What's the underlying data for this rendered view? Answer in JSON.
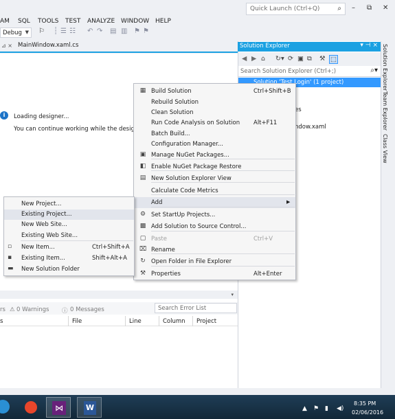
{
  "menubar": {
    "items": [
      "AM",
      "SQL",
      "TOOLS",
      "TEST",
      "ANALYZE",
      "WINDOW",
      "HELP"
    ],
    "quick_launch_placeholder": "Quick Launch (Ctrl+Q)"
  },
  "window_controls": [
    "–",
    "⧉",
    "✕"
  ],
  "toolbar": {
    "config_value": "Debug"
  },
  "editor": {
    "tab_label": "MainWindow.xaml.cs",
    "loading_text": "Loading designer...",
    "continue_text": "You can continue working while the designer is"
  },
  "error_list": {
    "errors_fragment": "rs",
    "warnings": "0 Warnings",
    "messages": "0 Messages",
    "search_placeholder": "Search Error List",
    "columns": [
      "File",
      "Line",
      "Column",
      "Project"
    ]
  },
  "solution_explorer": {
    "title": "Solution Explorer",
    "search_placeholder": "Search Solution Explorer (Ctrl+;)",
    "selected_item": "Solution 'Test Login' (1 project)",
    "visible_fragments": [
      "es",
      "ndow.xaml"
    ]
  },
  "side_tabs": [
    "Solution Explorer",
    "Team Explorer",
    "Class View"
  ],
  "context_menu": [
    {
      "icon": "build-icon",
      "glyph": "▦",
      "label": "Build Solution",
      "shortcut": "Ctrl+Shift+B"
    },
    {
      "icon": "",
      "glyph": "",
      "label": "Rebuild Solution",
      "shortcut": ""
    },
    {
      "icon": "",
      "glyph": "",
      "label": "Clean Solution",
      "shortcut": ""
    },
    {
      "icon": "",
      "glyph": "",
      "label": "Run Code Analysis on Solution",
      "shortcut": "Alt+F11"
    },
    {
      "icon": "",
      "glyph": "",
      "label": "Batch Build...",
      "shortcut": ""
    },
    {
      "icon": "",
      "glyph": "",
      "label": "Configuration Manager...",
      "shortcut": ""
    },
    {
      "icon": "nuget-icon",
      "glyph": "▣",
      "label": "Manage NuGet Packages...",
      "shortcut": ""
    },
    {
      "icon": "nuget-restore-icon",
      "glyph": "◧",
      "label": "Enable NuGet Package Restore",
      "shortcut": ""
    },
    {
      "icon": "new-view-icon",
      "glyph": "▤",
      "label": "New Solution Explorer View",
      "shortcut": ""
    },
    {
      "icon": "",
      "glyph": "",
      "label": "Calculate Code Metrics",
      "shortcut": ""
    },
    {
      "icon": "",
      "glyph": "",
      "label": "Add",
      "shortcut": "",
      "submenu": true
    },
    {
      "icon": "gear-icon",
      "glyph": "⚙",
      "label": "Set StartUp Projects...",
      "shortcut": ""
    },
    {
      "icon": "source-control-icon",
      "glyph": "▩",
      "label": "Add Solution to Source Control...",
      "shortcut": ""
    },
    {
      "icon": "paste-icon",
      "glyph": "▢",
      "label": "Paste",
      "shortcut": "Ctrl+V",
      "disabled": true
    },
    {
      "icon": "rename-icon",
      "glyph": "⌧",
      "label": "Rename",
      "shortcut": ""
    },
    {
      "icon": "folder-icon",
      "glyph": "↻",
      "label": "Open Folder in File Explorer",
      "shortcut": ""
    },
    {
      "icon": "wrench-icon",
      "glyph": "⚒",
      "label": "Properties",
      "shortcut": "Alt+Enter"
    }
  ],
  "add_submenu": [
    {
      "icon": "",
      "glyph": "",
      "label": "New Project...",
      "shortcut": ""
    },
    {
      "icon": "",
      "glyph": "",
      "label": "Existing Project...",
      "shortcut": ""
    },
    {
      "icon": "",
      "glyph": "",
      "label": "New Web Site...",
      "shortcut": ""
    },
    {
      "icon": "",
      "glyph": "",
      "label": "Existing Web Site...",
      "shortcut": ""
    },
    {
      "icon": "new-item-icon",
      "glyph": "▫",
      "label": "New Item...",
      "shortcut": "Ctrl+Shift+A"
    },
    {
      "icon": "existing-item-icon",
      "glyph": "▪",
      "label": "Existing Item...",
      "shortcut": "Shift+Alt+A"
    },
    {
      "icon": "solution-folder-icon",
      "glyph": "▬",
      "label": "New Solution Folder",
      "shortcut": ""
    }
  ],
  "taskbar": {
    "time": "8:35 PM",
    "date": "02/06/2016"
  }
}
